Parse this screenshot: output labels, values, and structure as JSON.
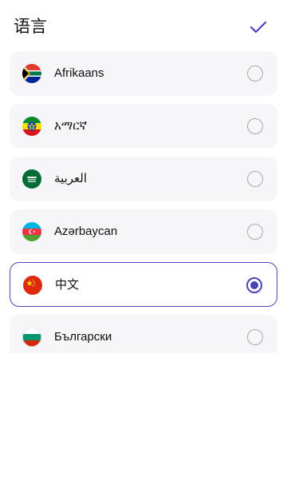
{
  "header": {
    "title": "语言",
    "confirm_icon": "check-icon"
  },
  "colors": {
    "accent": "#4a44b8",
    "item_bg": "#f6f6f9",
    "radio_border": "#a7a7b2"
  },
  "languages": [
    {
      "label": "Afrikaans",
      "flag": "south-africa-flag-icon",
      "selected": false
    },
    {
      "label": "አማርኛ",
      "flag": "ethiopia-flag-icon",
      "selected": false
    },
    {
      "label": "العربية",
      "flag": "saudi-arabia-flag-icon",
      "selected": false
    },
    {
      "label": "Azərbaycan",
      "flag": "azerbaijan-flag-icon",
      "selected": false
    },
    {
      "label": "中文",
      "flag": "china-flag-icon",
      "selected": true
    },
    {
      "label": "Български",
      "flag": "bulgaria-flag-icon",
      "selected": false
    }
  ]
}
